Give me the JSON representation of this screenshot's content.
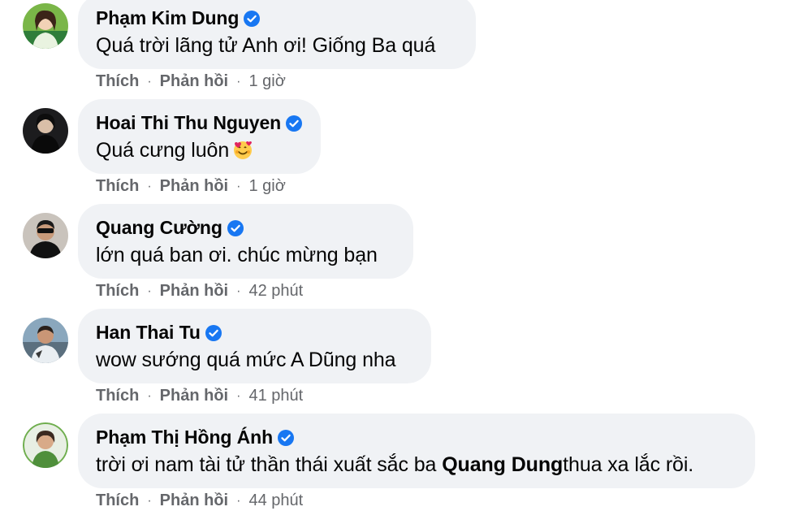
{
  "colors": {
    "bubble": "#f0f2f5",
    "verified": "#1877f2",
    "meta_text": "#65676b",
    "text": "#050505"
  },
  "comments": [
    {
      "author": "Phạm Kim Dung",
      "text": "Quá trời lãng tử Anh ơi! Giống Ba quá",
      "like_label": "Thích",
      "reply_label": "Phản hồi",
      "time": "1 giờ"
    },
    {
      "author": "Hoai Thi Thu Nguyen",
      "text": "Quá cưng luôn",
      "emoji": "smiling-face-with-hearts-icon",
      "like_label": "Thích",
      "reply_label": "Phản hồi",
      "time": "1 giờ"
    },
    {
      "author": "Quang Cường",
      "text": "lớn quá ban ơi. chúc mừng bạn",
      "like_label": "Thích",
      "reply_label": "Phản hồi",
      "time": "42 phút"
    },
    {
      "author": "Han Thai Tu",
      "text": "wow sướng quá mức A Dũng nha",
      "like_label": "Thích",
      "reply_label": "Phản hồi",
      "time": "41 phút"
    },
    {
      "author": "Phạm Thị Hồng Ánh",
      "text_before": "trời ơi nam tài tử thần thái xuất sắc ba ",
      "mention": "Quang Dung",
      "text_after": "thua xa lắc rồi.",
      "like_label": "Thích",
      "reply_label": "Phản hồi",
      "time": "44 phút"
    }
  ]
}
